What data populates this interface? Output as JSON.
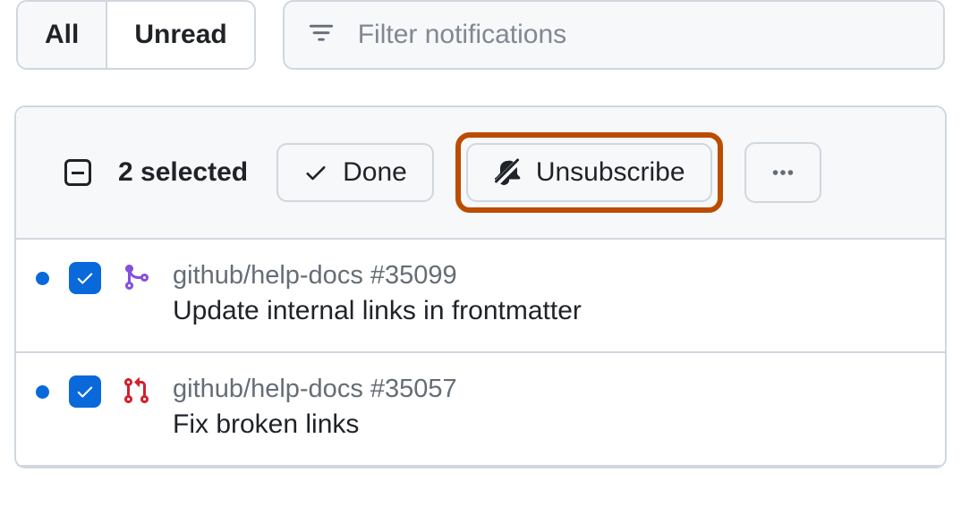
{
  "tabs": {
    "all": "All",
    "unread": "Unread"
  },
  "filter": {
    "placeholder": "Filter notifications"
  },
  "header": {
    "selected_label": "2 selected",
    "done_label": "Done",
    "unsubscribe_label": "Unsubscribe"
  },
  "items": [
    {
      "repo": "github/help-docs",
      "number": "#35099",
      "title": "Update internal links in frontmatter",
      "type": "merged-pr",
      "checked": true,
      "unread": true
    },
    {
      "repo": "github/help-docs",
      "number": "#35057",
      "title": "Fix broken links",
      "type": "open-pr",
      "checked": true,
      "unread": true
    }
  ]
}
